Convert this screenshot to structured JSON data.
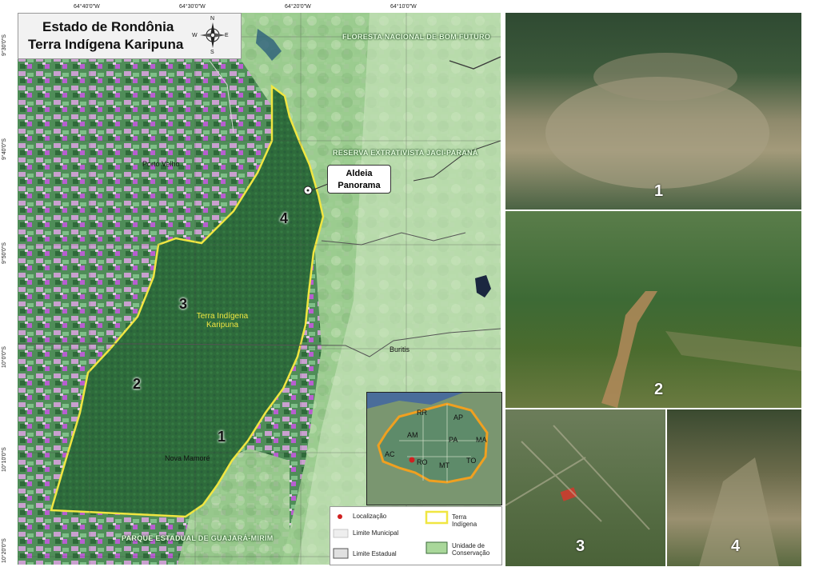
{
  "title": {
    "line1": "Estado de Rondônia",
    "line2": "Terra Indígena Karipuna"
  },
  "compass": {
    "n": "N",
    "s": "S",
    "e": "E",
    "w": "W"
  },
  "coords": {
    "top": [
      "64°40'0\"W",
      "64°30'0\"W",
      "64°20'0\"W",
      "64°10'0\"W"
    ],
    "left": [
      "9°30'0\"S",
      "9°40'0\"S",
      "9°50'0\"S",
      "10°0'0\"S",
      "10°10'0\"S",
      "10°20'0\"S"
    ]
  },
  "places": {
    "floresta": "FLORESTA NACIONAL DE BOM FUTURO",
    "reserva": "RESERVA EXTRATIVISTA JACI-PARANÁ",
    "porto_velho": "Porto Velho",
    "buritis": "Buritis",
    "nova_mamore": "Nova Mamoré",
    "parque": "PARQUE ESTADUAL DE GUAJARÁ-MIRIM",
    "terra_line1": "Terra Indígena",
    "terra_line2": "Karipuna"
  },
  "callout": {
    "line1": "Aldeia",
    "line2": "Panorama"
  },
  "map_numbers": [
    "1",
    "2",
    "3",
    "4"
  ],
  "inset_states": [
    "RR",
    "AP",
    "AM",
    "PA",
    "MA",
    "AC",
    "RO",
    "MT",
    "TO"
  ],
  "legend": {
    "localizacao": "Localização",
    "limite_municipal": "Limite Municipal",
    "limite_estadual": "Limite Estadual",
    "terra_line1": "Terra",
    "terra_line2": "Indígena",
    "uc_line1": "Unidade de",
    "uc_line2": "Conservação"
  },
  "photo_numbers": [
    "1",
    "2",
    "3",
    "4"
  ],
  "colors": {
    "boundary": "#f0e641",
    "forest": "#2f6e3c",
    "conservation": "#a9d79a",
    "location": "#d02020"
  }
}
